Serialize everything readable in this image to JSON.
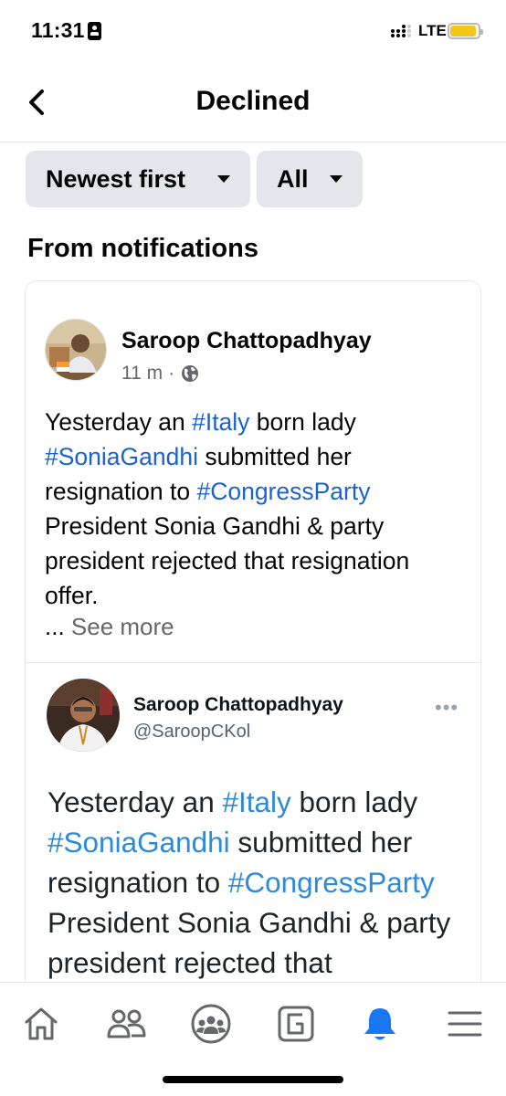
{
  "status_bar": {
    "time": "11:31",
    "network": "LTE",
    "battery_color": "#f5c518"
  },
  "header": {
    "title": "Declined",
    "back_icon": "chevron-left-icon"
  },
  "filters": {
    "sort_label": "Newest first",
    "type_label": "All"
  },
  "section": {
    "title": "From notifications"
  },
  "post": {
    "author": "Saroop Chattopadhyay",
    "time": "11 m",
    "privacy_icon": "globe-icon",
    "text": [
      {
        "t": "Yesterday an ",
        "tag": false
      },
      {
        "t": "#Italy",
        "tag": true
      },
      {
        "t": " born lady ",
        "tag": false
      },
      {
        "t": "#SoniaGandhi",
        "tag": true
      },
      {
        "t": " submitted her resignation to ",
        "tag": false
      },
      {
        "t": "#CongressParty",
        "tag": true
      },
      {
        "t": " President Sonia Gandhi & party president rejected that resignation offer.",
        "tag": false
      }
    ],
    "see_more_prefix": "...",
    "see_more": "See more",
    "hashtag_color": "#1b62d1"
  },
  "tweet": {
    "name": "Saroop Chattopadhyay",
    "handle": "@SaroopCKol",
    "more": "•••",
    "text": [
      {
        "t": "Yesterday an ",
        "tag": false
      },
      {
        "t": "#Italy",
        "tag": true
      },
      {
        "t": " born lady ",
        "tag": false
      },
      {
        "t": "#SoniaGandhi",
        "tag": true
      },
      {
        "t": " submitted her resignation to ",
        "tag": false
      },
      {
        "t": "#CongressParty",
        "tag": true
      },
      {
        "t": " President Sonia Gandhi & party president rejected that",
        "tag": false
      }
    ],
    "hashtag_color": "#2e8ad6"
  },
  "bottom_nav": {
    "items": [
      {
        "icon": "home-icon",
        "active": false
      },
      {
        "icon": "friends-icon",
        "active": false
      },
      {
        "icon": "groups-icon",
        "active": false
      },
      {
        "icon": "gaming-icon",
        "active": false
      },
      {
        "icon": "bell-icon",
        "active": true
      },
      {
        "icon": "menu-icon",
        "active": false
      }
    ],
    "active_color": "#1877f2"
  }
}
